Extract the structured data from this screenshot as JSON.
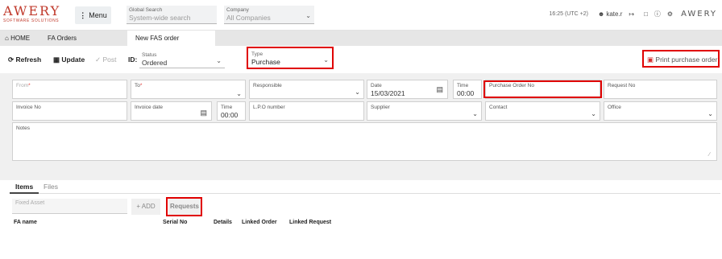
{
  "app": {
    "brand": "AWERY",
    "brand_sub": "SOFTWARE SOLUTIONS",
    "menu_label": "Menu",
    "global_search": {
      "label": "Global Search",
      "placeholder": "System-wide search"
    },
    "company": {
      "label": "Company",
      "value": "All Companies"
    },
    "time": "16:25 (UTC +2)",
    "user": "kate.r",
    "brand_right": "AWERY"
  },
  "tabs": [
    {
      "label": "HOME"
    },
    {
      "label": "FA Orders"
    },
    {
      "label": "New FAS order"
    }
  ],
  "toolbar": {
    "refresh": "Refresh",
    "update": "Update",
    "post": "Post",
    "id_label": "ID:",
    "status": {
      "label": "Status",
      "value": "Ordered"
    },
    "type": {
      "label": "Type",
      "value": "Purchase"
    },
    "print": "Print purchase order"
  },
  "form": {
    "from": {
      "label": "From",
      "value": ""
    },
    "to": {
      "label": "To",
      "value": ""
    },
    "responsible": {
      "label": "Responsible",
      "value": ""
    },
    "date": {
      "label": "Date",
      "value": "15/03/2021"
    },
    "time1": {
      "label": "Time",
      "value": "00:00"
    },
    "po_no": {
      "label": "Purchase Order No",
      "value": ""
    },
    "request_no": {
      "label": "Request No",
      "value": ""
    },
    "invoice_no": {
      "label": "Invoice No",
      "value": ""
    },
    "invoice_date": {
      "label": "Invoice date",
      "value": ""
    },
    "time2": {
      "label": "Time",
      "value": "00:00"
    },
    "lpo": {
      "label": "L.P.O number",
      "value": ""
    },
    "supplier": {
      "label": "Supplier",
      "value": ""
    },
    "contact": {
      "label": "Contact",
      "value": ""
    },
    "office": {
      "label": "Office",
      "value": ""
    },
    "notes": {
      "label": "Notes",
      "value": ""
    }
  },
  "items": {
    "tabs": [
      "Items",
      "Files"
    ],
    "fixed_asset_placeholder": "Fixed Asset",
    "add": "+ ADD",
    "requests": "Requests",
    "columns": [
      "FA name",
      "Serial No",
      "Details",
      "Linked Order",
      "Linked Request"
    ]
  },
  "colors": {
    "brand": "#c0392b",
    "highlight": "#e00000"
  }
}
